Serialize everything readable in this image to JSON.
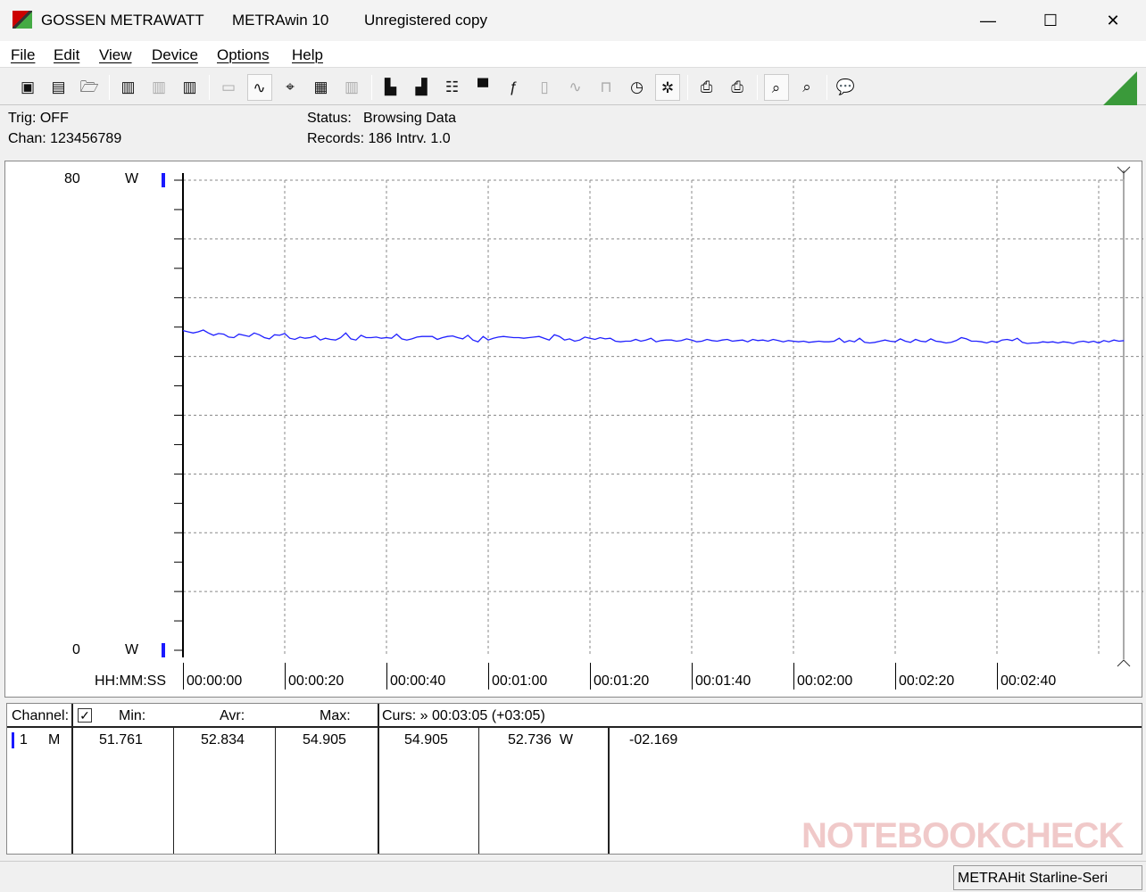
{
  "window": {
    "company": "GOSSEN METRAWATT",
    "app": "METRAwin 10",
    "registration": "Unregistered copy"
  },
  "menu": [
    "File",
    "Edit",
    "View",
    "Device",
    "Options",
    "Help"
  ],
  "toolbar": [
    {
      "icon": "save-icon",
      "glyph": "▣"
    },
    {
      "icon": "save-as-icon",
      "glyph": "▤"
    },
    {
      "icon": "open-folder-icon",
      "glyph": "🗁"
    },
    {
      "icon": "device-read-icon",
      "glyph": "▥"
    },
    {
      "icon": "device-transfer-icon",
      "glyph": "▥",
      "disabled": true
    },
    {
      "icon": "device-memory-icon",
      "glyph": "▥"
    },
    {
      "icon": "display-icon",
      "glyph": "▭",
      "disabled": true
    },
    {
      "icon": "waveform-view-icon",
      "glyph": "∿",
      "active": true
    },
    {
      "icon": "crosshair-icon",
      "glyph": "⌖"
    },
    {
      "icon": "table-view-icon",
      "glyph": "▦"
    },
    {
      "icon": "histogram-icon",
      "glyph": "▥",
      "disabled": true
    },
    {
      "icon": "export-icon",
      "glyph": "▙"
    },
    {
      "icon": "import-icon",
      "glyph": "▟"
    },
    {
      "icon": "list-settings-icon",
      "glyph": "☷"
    },
    {
      "icon": "monitor-icon",
      "glyph": "▀"
    },
    {
      "icon": "function-icon",
      "glyph": "ƒ"
    },
    {
      "icon": "meter-icon",
      "glyph": "▯",
      "disabled": true
    },
    {
      "icon": "signal-icon",
      "glyph": "∿",
      "disabled": true
    },
    {
      "icon": "pulse-icon",
      "glyph": "⊓",
      "disabled": true
    },
    {
      "icon": "clock-icon",
      "glyph": "◷"
    },
    {
      "icon": "trigger-bug-icon",
      "glyph": "✲",
      "active": true
    },
    {
      "icon": "print-preview-icon",
      "glyph": "⎙"
    },
    {
      "icon": "print-icon",
      "glyph": "⎙"
    },
    {
      "icon": "zoom-wave-icon",
      "glyph": "⌕",
      "active": true
    },
    {
      "icon": "zoom-signal-icon",
      "glyph": "⌕"
    },
    {
      "icon": "comment-icon",
      "glyph": "💬"
    }
  ],
  "info": {
    "trig": "Trig: OFF",
    "chan": "Chan:  123456789",
    "status_label": "Status:",
    "status_value": "Browsing Data",
    "records": "Records: 186  Intrv. 1.0"
  },
  "chart_data": {
    "type": "line",
    "ylim": [
      0,
      80
    ],
    "y_unit": "W",
    "y_ticks": [
      "80",
      "0"
    ],
    "xlabel": "HH:MM:SS",
    "x_ticks": [
      "00:00:00",
      "00:00:20",
      "00:00:40",
      "00:01:00",
      "00:01:20",
      "00:01:40",
      "00:02:00",
      "00:02:20",
      "00:02:40"
    ],
    "x_interval_s": 1,
    "grid": true,
    "line_color": "#2020ff",
    "values": [
      54.4,
      54.2,
      54.0,
      54.2,
      54.5,
      54.0,
      53.6,
      53.9,
      53.8,
      53.3,
      53.2,
      53.8,
      53.6,
      53.4,
      54.0,
      53.7,
      53.2,
      53.0,
      53.7,
      53.6,
      53.9,
      53.1,
      52.9,
      53.3,
      53.1,
      53.2,
      53.5,
      52.8,
      53.1,
      52.9,
      52.8,
      53.2,
      54.0,
      53.0,
      52.8,
      53.6,
      53.2,
      53.2,
      53.3,
      53.1,
      53.2,
      53.1,
      53.8,
      53.0,
      52.8,
      53.0,
      53.3,
      53.4,
      53.4,
      53.4,
      52.9,
      53.2,
      53.4,
      53.5,
      53.2,
      53.0,
      53.6,
      52.8,
      52.5,
      53.4,
      52.8,
      53.1,
      53.3,
      53.4,
      53.3,
      53.2,
      53.2,
      53.1,
      53.2,
      53.3,
      53.4,
      53.1,
      52.8,
      53.7,
      53.4,
      52.8,
      53.0,
      52.6,
      52.8,
      53.3,
      53.1,
      52.9,
      53.2,
      53.0,
      53.1,
      52.6,
      52.5,
      52.6,
      52.6,
      52.9,
      52.6,
      52.8,
      53.1,
      52.5,
      52.7,
      52.8,
      52.8,
      52.6,
      52.7,
      53.0,
      52.8,
      52.5,
      52.6,
      52.9,
      52.7,
      52.6,
      52.8,
      52.9,
      52.6,
      52.7,
      52.8,
      52.5,
      52.9,
      52.7,
      52.8,
      52.6,
      52.9,
      52.7,
      52.5,
      52.7,
      52.6,
      52.5,
      52.6,
      52.4,
      52.5,
      52.6,
      52.5,
      52.5,
      52.6,
      53.1,
      52.4,
      52.7,
      52.5,
      53.1,
      52.4,
      52.3,
      52.4,
      52.6,
      52.8,
      52.6,
      52.5,
      53.0,
      52.6,
      52.4,
      52.9,
      52.6,
      52.5,
      53.0,
      52.6,
      52.5,
      52.3,
      52.4,
      52.7,
      53.2,
      53.0,
      52.6,
      52.6,
      52.5,
      52.3,
      52.6,
      52.4,
      52.8,
      52.9,
      52.7,
      53.1,
      52.4,
      52.2,
      52.3,
      52.3,
      52.5,
      52.4,
      52.5,
      52.3,
      52.5,
      52.4,
      52.2,
      52.5,
      52.6,
      52.4,
      52.6,
      52.3,
      52.7,
      52.5,
      52.8,
      52.6,
      52.7
    ]
  },
  "table": {
    "headers": {
      "channel": "Channel:",
      "min": "Min:",
      "avr": "Avr:",
      "max": "Max:",
      "cursor": "Curs: » 00:03:05 (+03:05)"
    },
    "row": {
      "num": "1",
      "mode": "M",
      "min": "51.761",
      "avr": "52.834",
      "max": "54.905",
      "curs1": "54.905",
      "curs2": "52.736  W",
      "diff": "-02.169",
      "color": "#1a1aff"
    }
  },
  "status": {
    "device": "METRAHit Starline-Seri"
  },
  "watermark": "NOTEBOOKCHECK"
}
